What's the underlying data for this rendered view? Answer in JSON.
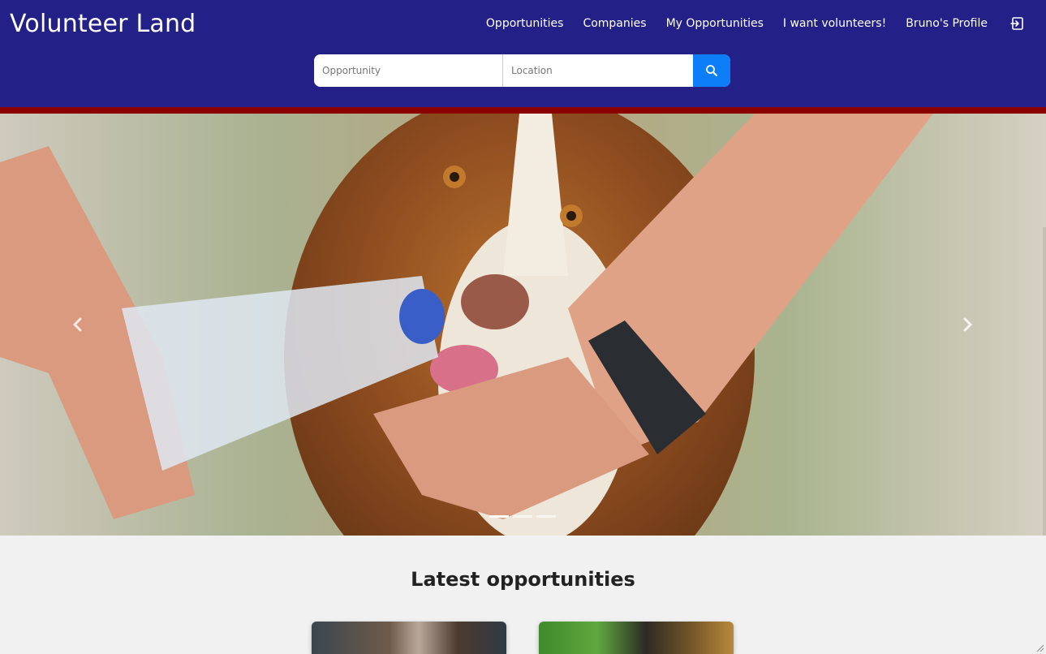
{
  "brand": "Volunteer Land",
  "nav": {
    "items": [
      {
        "label": "Opportunities"
      },
      {
        "label": "Companies"
      },
      {
        "label": "My Opportunities"
      },
      {
        "label": "I want volunteers!"
      },
      {
        "label": "Bruno's Profile"
      }
    ],
    "logout_icon": "sign-out-icon"
  },
  "search": {
    "opportunity_placeholder": "Opportunity",
    "location_placeholder": "Location",
    "button_icon": "search-icon"
  },
  "carousel": {
    "slide_image": "dog-drinking-water-from-hands-photo",
    "prev_icon": "chevron-left-icon",
    "next_icon": "chevron-right-icon",
    "slide_count": 3,
    "active_slide": 1
  },
  "latest": {
    "title": "Latest opportunities"
  },
  "colors": {
    "header_bg": "#232187",
    "accent_line": "#8b0000",
    "search_button": "#0d7ef7",
    "page_bg": "#f1f1f1"
  }
}
